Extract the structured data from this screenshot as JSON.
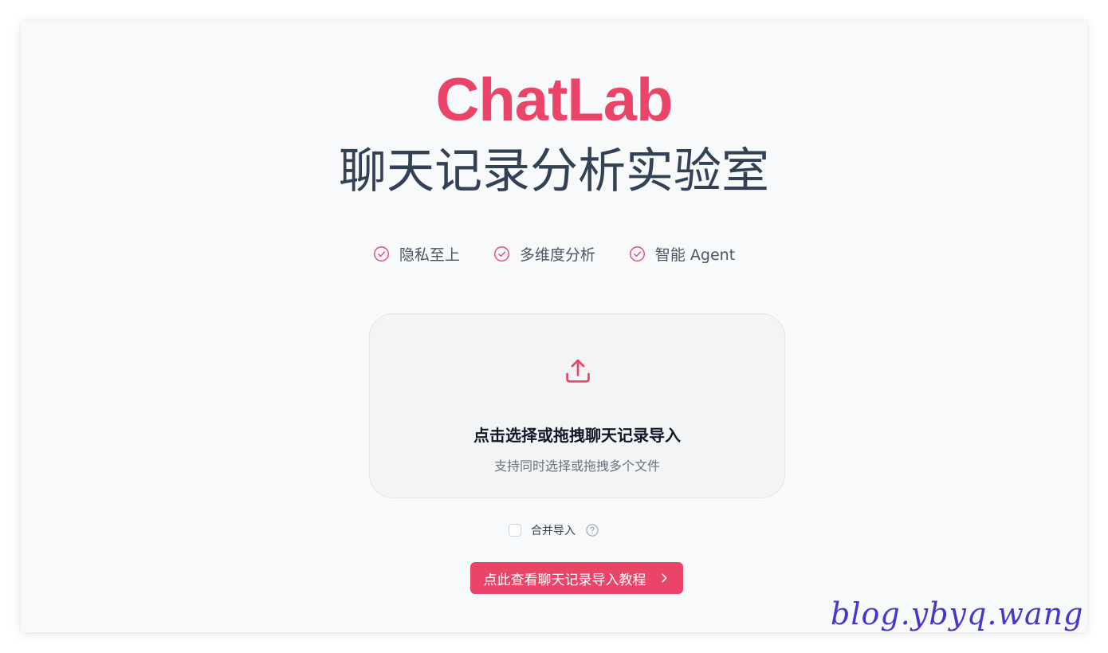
{
  "brand": {
    "name": "ChatLab",
    "subtitle": "聊天记录分析实验室",
    "accent_color": "#ea4468"
  },
  "features": [
    {
      "icon": "check-circle-icon",
      "label": "隐私至上"
    },
    {
      "icon": "check-circle-icon",
      "label": "多维度分析"
    },
    {
      "icon": "check-circle-icon",
      "label": "智能 Agent"
    }
  ],
  "dropzone": {
    "icon": "upload-icon",
    "title": "点击选择或拖拽聊天记录导入",
    "subtitle": "支持同时选择或拖拽多个文件"
  },
  "merge_import": {
    "label": "合并导入",
    "checked": false,
    "help_icon": "question-circle-icon"
  },
  "tutorial_button": {
    "label": "点此查看聊天记录导入教程",
    "icon": "chevron-right-icon"
  },
  "watermark": {
    "text": "blog.ybyq.wang",
    "color": "#4338ca"
  }
}
